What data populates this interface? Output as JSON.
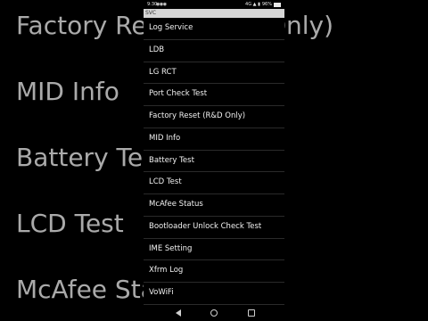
{
  "status_bar": {
    "time": "9:30",
    "indicators": "◉◉◉",
    "signal": "4G ▲ ▮",
    "battery_percent": "96%"
  },
  "app_bar": {
    "title": "SVC"
  },
  "menu": {
    "items": [
      {
        "label": "Log Service"
      },
      {
        "label": "LDB"
      },
      {
        "label": "LG RCT"
      },
      {
        "label": "Port Check Test"
      },
      {
        "label": "Factory Reset (R&D Only)"
      },
      {
        "label": "MID Info"
      },
      {
        "label": "Battery Test"
      },
      {
        "label": "LCD Test"
      },
      {
        "label": "McAfee Status"
      },
      {
        "label": "Bootloader Unlock Check Test"
      },
      {
        "label": "IME Setting"
      },
      {
        "label": "Xfrm Log"
      },
      {
        "label": "VoWiFi"
      }
    ]
  },
  "background_blur": {
    "labels": [
      "Factory Reset (R&D Only)",
      "MID Info",
      "Battery Test",
      "LCD Test",
      "McAfee Status"
    ]
  },
  "navigation_bar": {
    "back_icon": "back-triangle-icon",
    "home_icon": "home-circle-icon",
    "recents_icon": "recents-square-icon"
  },
  "colors": {
    "background": "#000000",
    "app_bar": "#d6d6d6",
    "text": "#f2f2f2",
    "divider": "#2a2a2a"
  }
}
